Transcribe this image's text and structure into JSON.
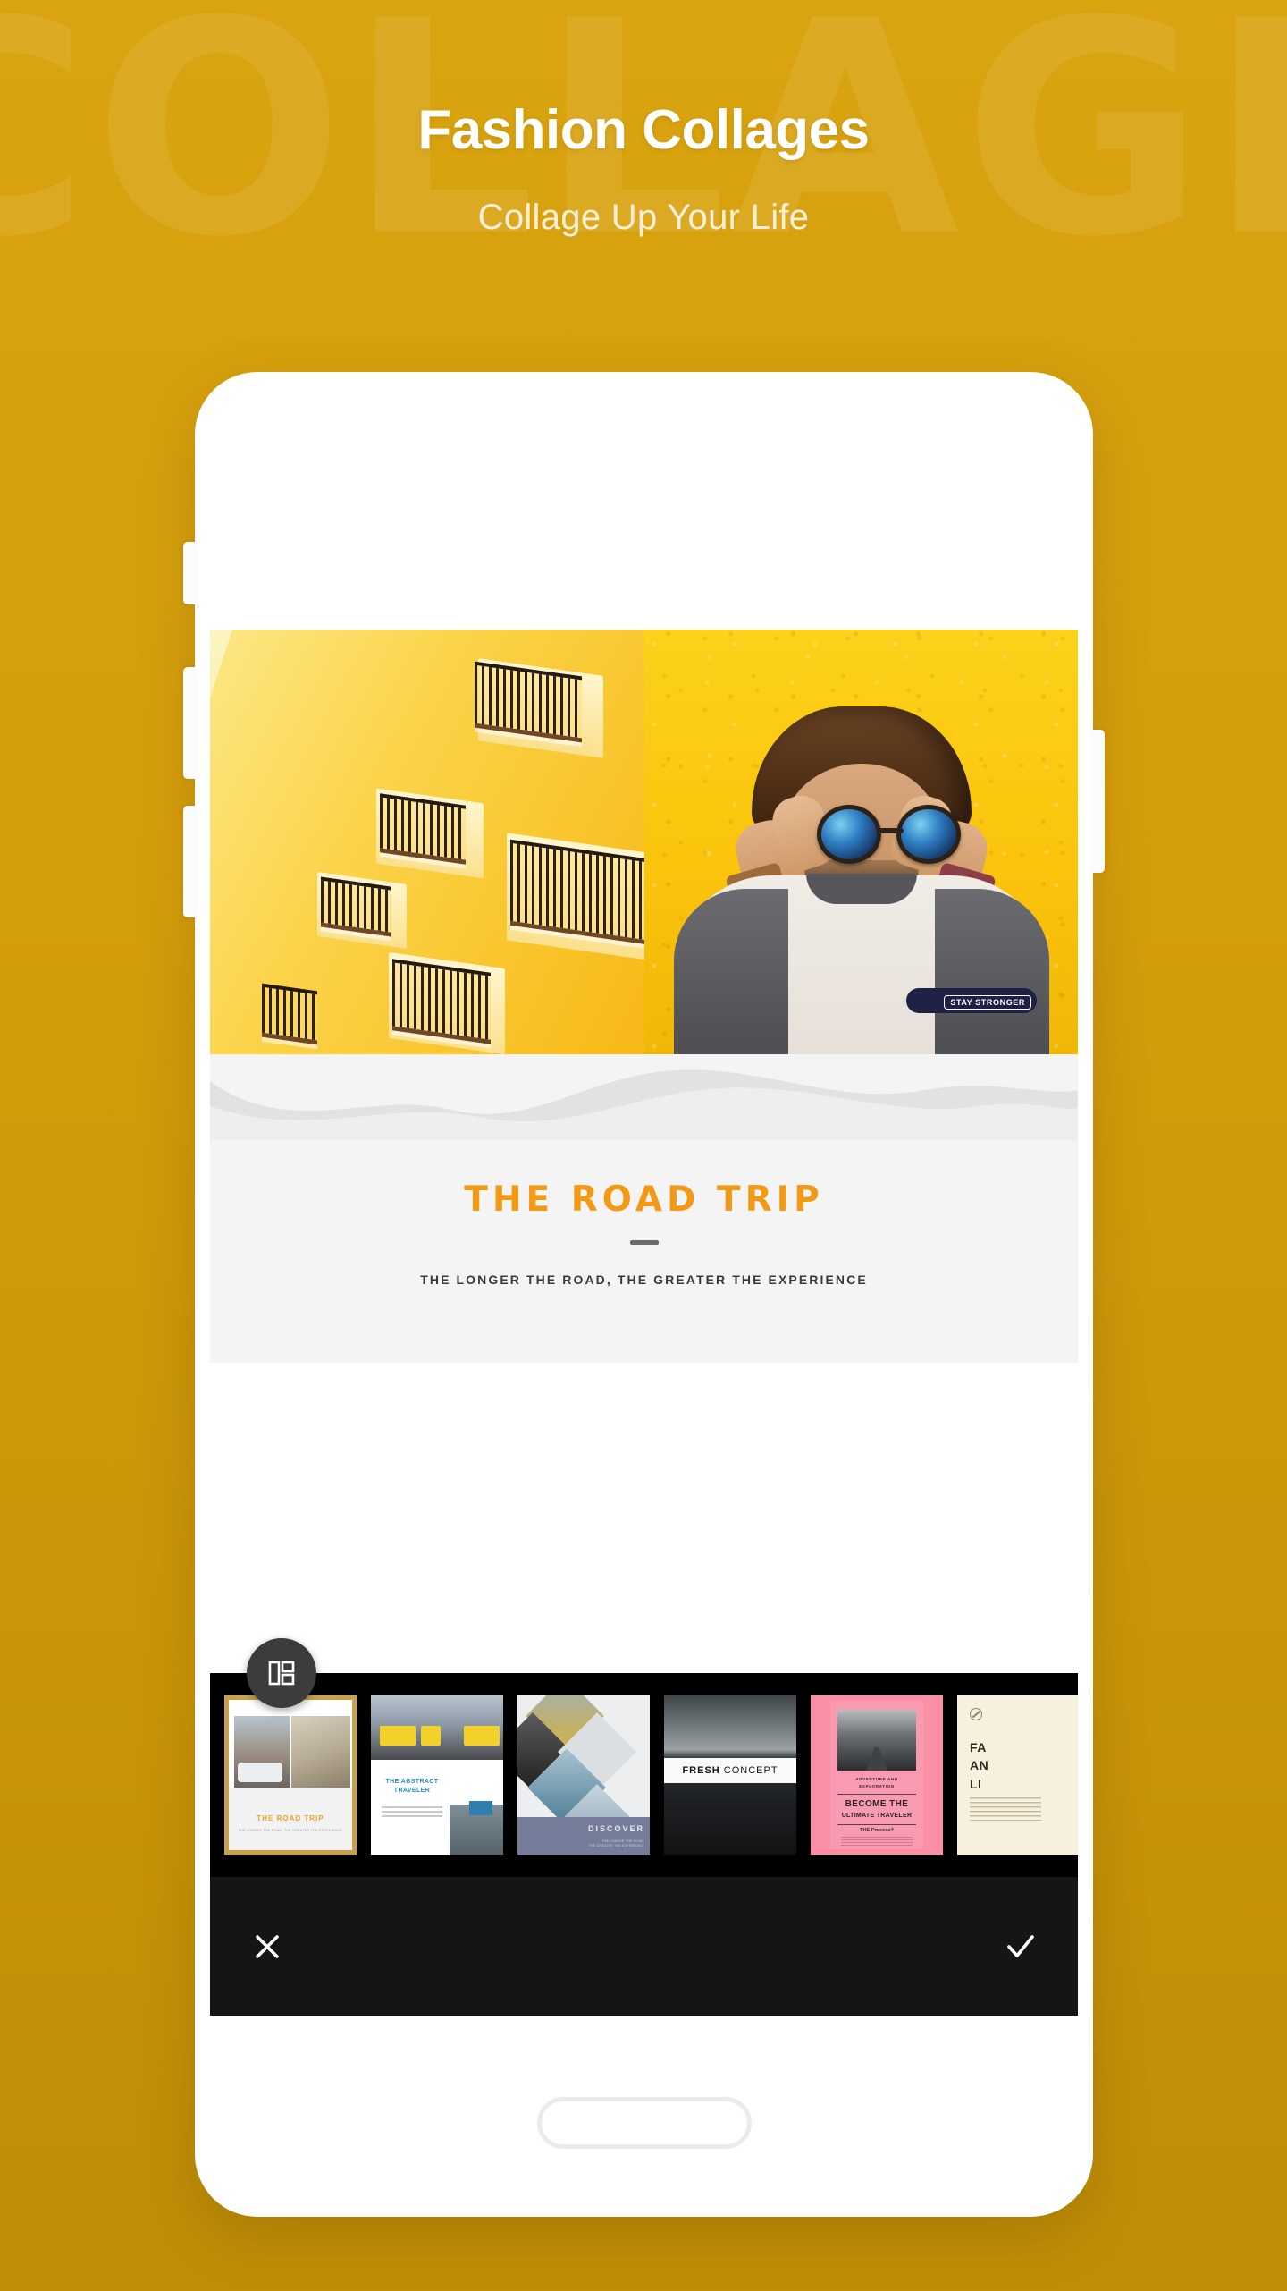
{
  "background": {
    "watermark_text": "COLLAGE",
    "base_color": "#d19b0d"
  },
  "header": {
    "title": "Fashion Collages",
    "subtitle": "Collage Up Your Life",
    "title_color": "#ffffff",
    "subtitle_color": "#f8efda"
  },
  "phone": {
    "collage": {
      "left_photo": {
        "name": "yellow-building-with-balconies",
        "description": "Yellow building facade with black wrought-iron balconies"
      },
      "right_photo": {
        "name": "man-adjusting-sunglasses",
        "description": "Man in sunglasses against a yellow textured wall",
        "shirt_badge_text": "STAY STRONGER"
      }
    },
    "caption": {
      "title": "THE ROAD TRIP",
      "subtitle": "THE LONGER THE ROAD, THE GREATER THE EXPERIENCE",
      "title_color": "#f29a15"
    },
    "layout_button": {
      "icon": "layout-grid-icon"
    },
    "thumbnails": [
      {
        "id": "road-trip",
        "label": "THE ROAD TRIP",
        "sublabel": "THE LONGER THE ROAD, THE GREATER THE EXPERIENCE",
        "selected": true
      },
      {
        "id": "abstract-traveler",
        "label": "THE ABSTRACT\nTRAVELER",
        "selected": false
      },
      {
        "id": "discover",
        "label": "DISCOVER",
        "sublabel": "THE LONGER THE ROAD,\nTHE GREATER THE EXPERIENCE",
        "selected": false
      },
      {
        "id": "fresh-concept",
        "label_bold": "FRESH",
        "label_light": "CONCEPT",
        "selected": false
      },
      {
        "id": "ultimate-traveler",
        "eyebrow": "ADVENTURE AND\nEXPLORATION",
        "label": "BECOME THE",
        "label2": "ULTIMATE TRAVELER",
        "footer": "THE Process?",
        "selected": false
      },
      {
        "id": "fashion-and-life",
        "label": "FA\nAN\nLI",
        "selected": false
      }
    ],
    "bottom_bar": {
      "cancel_icon": "close-x-icon",
      "confirm_icon": "checkmark-icon"
    }
  }
}
